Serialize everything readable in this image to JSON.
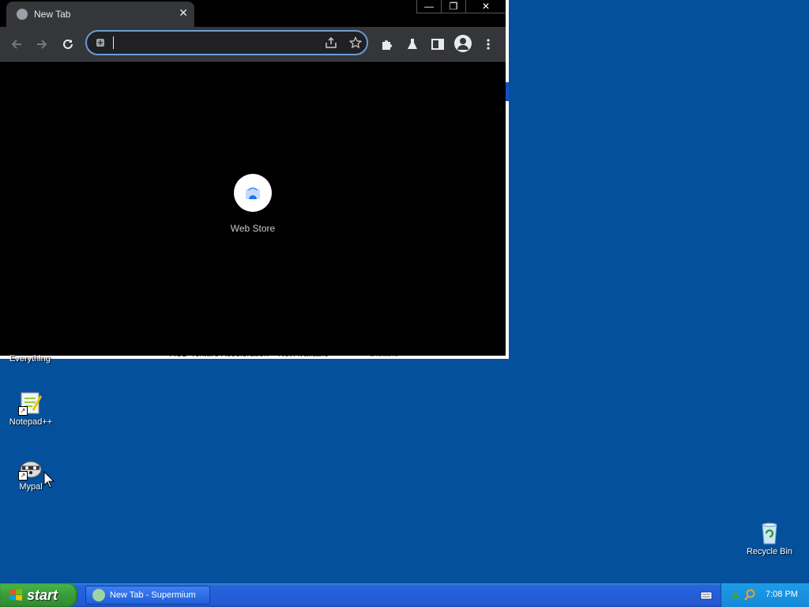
{
  "background_window": {
    "bottom_fragments": [
      "Everything",
      "ACD Texture Acceleration",
      "Not Available",
      "Disable"
    ]
  },
  "browser": {
    "tab": {
      "title": "New Tab",
      "close_glyph": "✕"
    },
    "window_controls": {
      "minimize": "—",
      "restore": "❐",
      "close": "✕"
    },
    "address_bar": {
      "value": "",
      "placeholder": ""
    },
    "shortcut": {
      "label": "Web Store"
    }
  },
  "desktop": {
    "icons": [
      {
        "label": "Everything"
      },
      {
        "label": "Notepad++"
      },
      {
        "label": "Mypal"
      },
      {
        "label": "Recycle Bin"
      }
    ]
  },
  "taskbar": {
    "start_label": "start",
    "task_button": "New Tab - Supermium",
    "clock": "7:08 PM"
  },
  "colors": {
    "desktop": "#04509c",
    "taskbar": "#245edb",
    "start": "#3a9b3b",
    "tray": "#1588d8"
  }
}
